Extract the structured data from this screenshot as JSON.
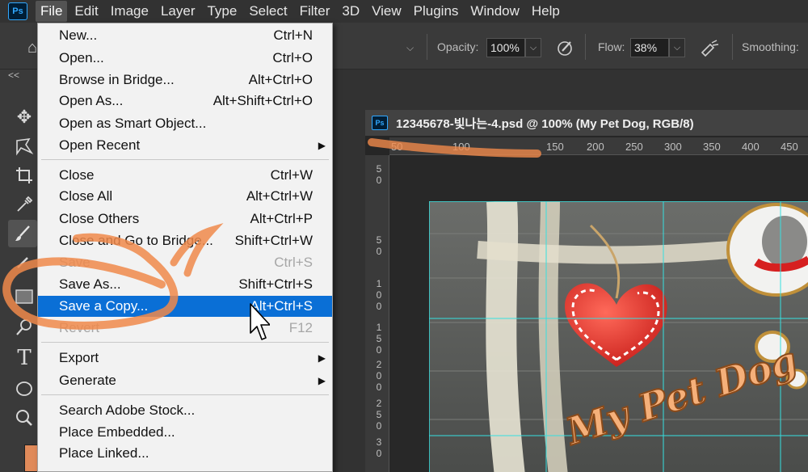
{
  "app": {
    "logo": "Ps"
  },
  "menubar": {
    "items": [
      "File",
      "Edit",
      "Image",
      "Layer",
      "Type",
      "Select",
      "Filter",
      "3D",
      "View",
      "Plugins",
      "Window",
      "Help"
    ],
    "active": "File"
  },
  "options_bar": {
    "opacity_label": "Opacity:",
    "opacity_value": "100%",
    "flow_label": "Flow:",
    "flow_value": "38%",
    "smoothing_label": "Smoothing:"
  },
  "toolbar": {
    "collapse": "<<"
  },
  "document": {
    "tab_title": "12345678-빛나는-4.psd @ 100% (My Pet Dog, RGB/8)",
    "ruler_h": [
      "50",
      "100",
      "150",
      "200",
      "250",
      "300",
      "350",
      "400",
      "450"
    ],
    "ruler_v": [
      "5\n0",
      "5\n0",
      "1\n0\n0",
      "1\n5\n0",
      "2\n0\n0",
      "2\n5\n0",
      "3\n0"
    ],
    "artwork_text": "My Pet Dog"
  },
  "file_menu": {
    "items": [
      {
        "label": "New...",
        "shortcut": "Ctrl+N"
      },
      {
        "label": "Open...",
        "shortcut": "Ctrl+O"
      },
      {
        "label": "Browse in Bridge...",
        "shortcut": "Alt+Ctrl+O"
      },
      {
        "label": "Open As...",
        "shortcut": "Alt+Shift+Ctrl+O"
      },
      {
        "label": "Open as Smart Object...",
        "shortcut": ""
      },
      {
        "label": "Open Recent",
        "shortcut": "",
        "submenu": true
      },
      {
        "label": "Close",
        "shortcut": "Ctrl+W"
      },
      {
        "label": "Close All",
        "shortcut": "Alt+Ctrl+W"
      },
      {
        "label": "Close Others",
        "shortcut": "Alt+Ctrl+P"
      },
      {
        "label": "Close and Go to Bridge...",
        "shortcut": "Shift+Ctrl+W"
      },
      {
        "label": "Save",
        "shortcut": "Ctrl+S",
        "disabled": true
      },
      {
        "label": "Save As...",
        "shortcut": "Shift+Ctrl+S"
      },
      {
        "label": "Save a Copy...",
        "shortcut": "Alt+Ctrl+S",
        "highlighted": true
      },
      {
        "label": "Revert",
        "shortcut": "F12",
        "disabled": true
      },
      {
        "label": "Export",
        "shortcut": "",
        "submenu": true
      },
      {
        "label": "Generate",
        "shortcut": "",
        "submenu": true
      },
      {
        "label": "Search Adobe Stock...",
        "shortcut": ""
      },
      {
        "label": "Place Embedded...",
        "shortcut": ""
      },
      {
        "label": "Place Linked...",
        "shortcut": ""
      }
    ]
  },
  "colors": {
    "highlight": "#0a6fd6",
    "annotation": "#f08a4b",
    "guide": "#35e0e0",
    "heart": "#e8302a"
  }
}
